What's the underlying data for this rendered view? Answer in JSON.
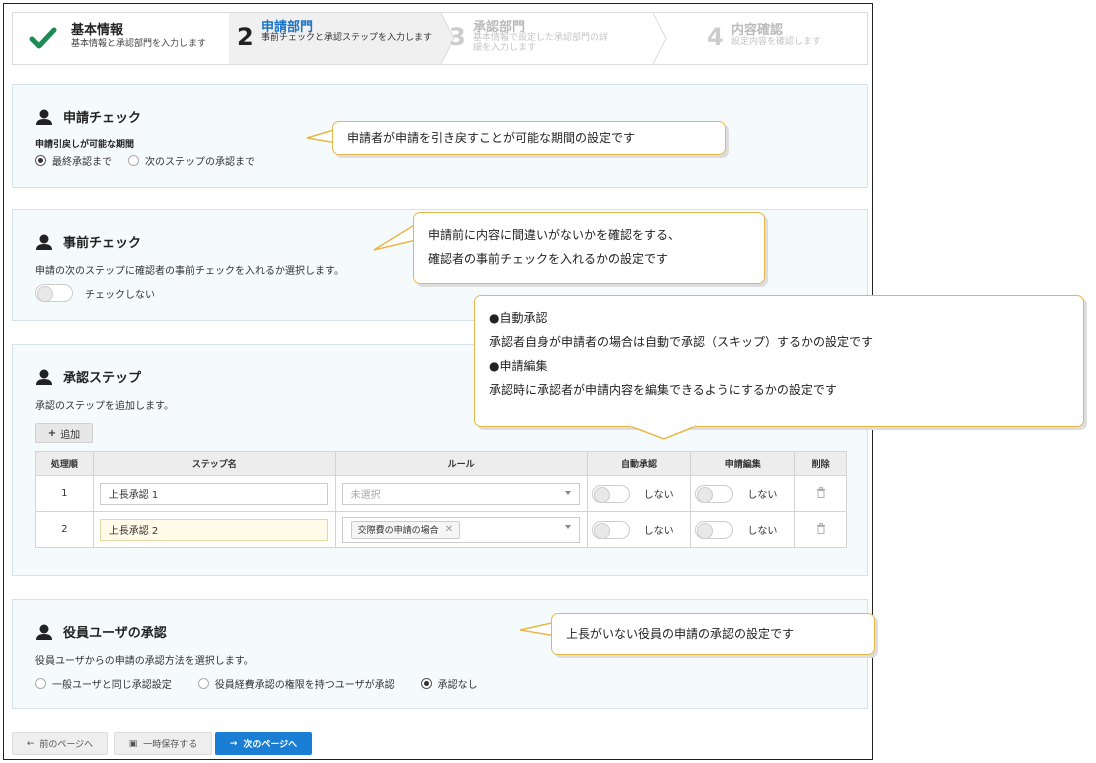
{
  "stepper": {
    "steps": [
      {
        "num": "",
        "title": "基本情報",
        "sub": "基本情報と承認部門を入力します",
        "state": "done"
      },
      {
        "num": "2",
        "title": "申請部門",
        "sub": "事前チェックと承認ステップを入力します",
        "state": "active"
      },
      {
        "num": "3",
        "title": "承認部門",
        "sub": "基本情報で設定した承認部門の詳細を入力します",
        "state": "pending"
      },
      {
        "num": "4",
        "title": "内容確認",
        "sub": "設定内容を確認します",
        "state": "pending"
      }
    ]
  },
  "sections": {
    "request_check": {
      "title": "申請チェック",
      "period_label": "申請引戻しが可能な期間",
      "options": [
        "最終承認まで",
        "次のステップの承認まで"
      ],
      "selected": 0
    },
    "pre_check": {
      "title": "事前チェック",
      "desc": "申請の次のステップに確認者の事前チェックを入れるか選択します。",
      "toggle_label": "チェックしない"
    },
    "approval_steps": {
      "title": "承認ステップ",
      "desc": "承認のステップを追加します。",
      "add_label": "追加",
      "columns": [
        "処理順",
        "ステップ名",
        "ルール",
        "自動承認",
        "申請編集",
        "削除"
      ],
      "rows": [
        {
          "order": "1",
          "name": "上長承認 1",
          "rule_placeholder": "未選択",
          "rule_tag": "",
          "auto": "しない",
          "edit": "しない"
        },
        {
          "order": "2",
          "name": "上長承認 2",
          "rule_placeholder": "",
          "rule_tag": "交際費の申請の場合",
          "auto": "しない",
          "edit": "しない"
        }
      ]
    },
    "executive": {
      "title": "役員ユーザの承認",
      "desc": "役員ユーザからの申請の承認方法を選択します。",
      "options": [
        "一般ユーザと同じ承認設定",
        "役員経費承認の権限を持つユーザが承認",
        "承認なし"
      ],
      "selected": 2
    }
  },
  "footer": {
    "prev": "前のページへ",
    "save": "一時保存する",
    "next": "次のページへ"
  },
  "callouts": {
    "c1": "申請者が申請を引き戻すことが可能な期間の設定です",
    "c2_line1": "申請前に内容に間違いがないかを確認をする、",
    "c2_line2": "確認者の事前チェックを入れるかの設定です",
    "c3_line1": "●自動承認",
    "c3_line2": "承認者自身が申請者の場合は自動で承認（スキップ）するかの設定です",
    "c3_line3": "●申請編集",
    "c3_line4": "承認時に承認者が申請内容を編集できるようにするかの設定です",
    "c4": "上長がいない役員の申請の承認の設定です"
  },
  "colors": {
    "accent": "#1a7fd4",
    "check": "#1f8a56",
    "callout_border": "#e8b74a",
    "card_bg": "#f5fbfd"
  }
}
